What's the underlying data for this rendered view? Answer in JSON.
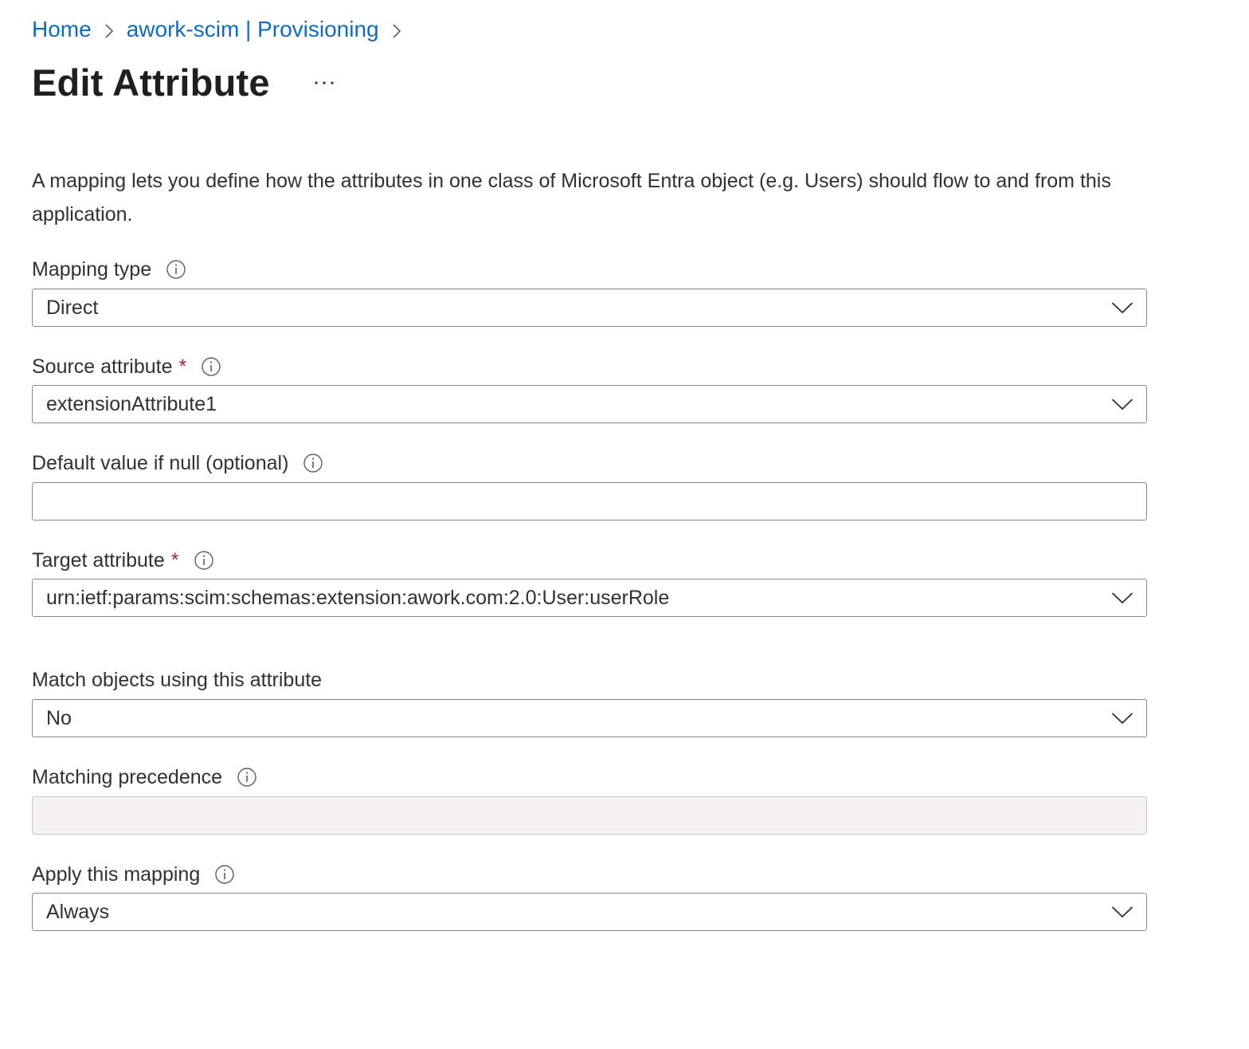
{
  "breadcrumb": {
    "items": [
      "Home",
      "awork-scim | Provisioning"
    ]
  },
  "header": {
    "title": "Edit Attribute",
    "more_label": "..."
  },
  "description": "A mapping lets you define how the attributes in one class of Microsoft Entra object (e.g. Users) should flow to and from this application.",
  "form": {
    "mapping_type": {
      "label": "Mapping type",
      "value": "Direct"
    },
    "source_attribute": {
      "label": "Source attribute",
      "required_mark": "*",
      "value": "extensionAttribute1"
    },
    "default_value": {
      "label": "Default value if null (optional)",
      "value": "",
      "placeholder": ""
    },
    "target_attribute": {
      "label": "Target attribute",
      "required_mark": "*",
      "value": "urn:ietf:params:scim:schemas:extension:awork.com:2.0:User:userRole"
    },
    "match_objects": {
      "label": "Match objects using this attribute",
      "value": "No"
    },
    "matching_precedence": {
      "label": "Matching precedence",
      "value": ""
    },
    "apply_mapping": {
      "label": "Apply this mapping",
      "value": "Always"
    }
  },
  "icons": {
    "info": "info-icon",
    "chevron": "chevron-down-icon",
    "breadcrumb_separator": "chevron-right-icon",
    "more": "more-icon"
  },
  "colors": {
    "link": "#0f6cbd",
    "required": "#a4262c",
    "border": "#8a8886",
    "disabled_bg": "#f3f2f1"
  }
}
